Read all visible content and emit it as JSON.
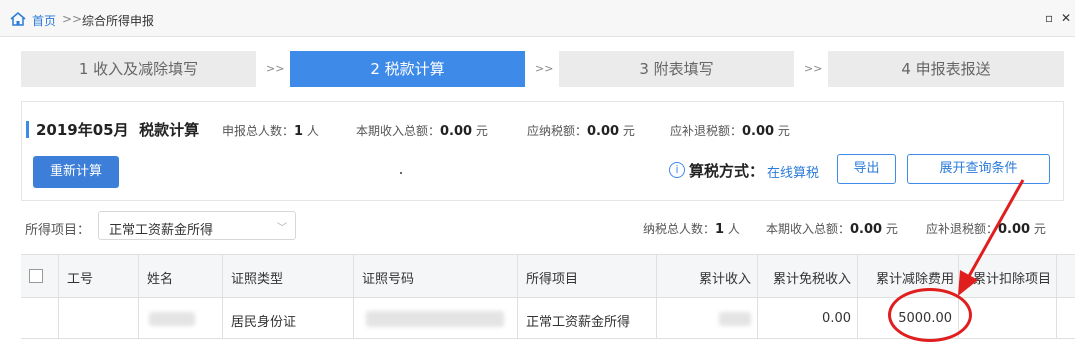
{
  "breadcrumb": {
    "home": "首页",
    "separator": ">>",
    "current": "综合所得申报"
  },
  "window_controls": {
    "restore": "▫",
    "close": "✕"
  },
  "steps": [
    {
      "label": "1 收入及减除填写",
      "active": false
    },
    {
      "label": "2 税款计算",
      "active": true
    },
    {
      "label": "3 附表填写",
      "active": false
    },
    {
      "label": "4 申报表报送",
      "active": false
    }
  ],
  "step_separator": ">>",
  "summary": {
    "period": "2019年05月",
    "title": "税款计算",
    "declarants_label": "申报总人数：",
    "declarants_value": "1",
    "declarants_unit": "人",
    "income_label": "本期收入总额：",
    "income_value": "0.00",
    "income_unit": "元",
    "tax_payable_label": "应纳税额：",
    "tax_payable_value": "0.00",
    "tax_payable_unit": "元",
    "refund_label": "应补退税额：",
    "refund_value": "0.00",
    "refund_unit": "元"
  },
  "actions": {
    "recalculate": "重新计算",
    "tax_method_label": "算税方式：",
    "tax_method_value": "在线算税",
    "export": "导出",
    "expand_query": "展开查询条件"
  },
  "filter": {
    "label": "所得项目：",
    "selected": "正常工资薪金所得",
    "taxpayers_label": "纳税总人数：",
    "taxpayers_value": "1",
    "taxpayers_unit": "人",
    "income_label": "本期收入总额：",
    "income_value": "0.00",
    "income_unit": "元",
    "refund_label": "应补退税额：",
    "refund_value": "0.00",
    "refund_unit": "元"
  },
  "table": {
    "headers": [
      "工号",
      "姓名",
      "证照类型",
      "证照号码",
      "所得项目",
      "累计收入",
      "累计免税收入",
      "累计减除费用",
      "累计扣除项目"
    ],
    "rows": [
      {
        "id_type": "居民身份证",
        "income_item": "正常工资薪金所得",
        "tax_free_income": "0.00",
        "deduction": "5000.00"
      }
    ]
  },
  "colors": {
    "accent": "#3d8ae8",
    "annotation": "#e01e1e"
  }
}
